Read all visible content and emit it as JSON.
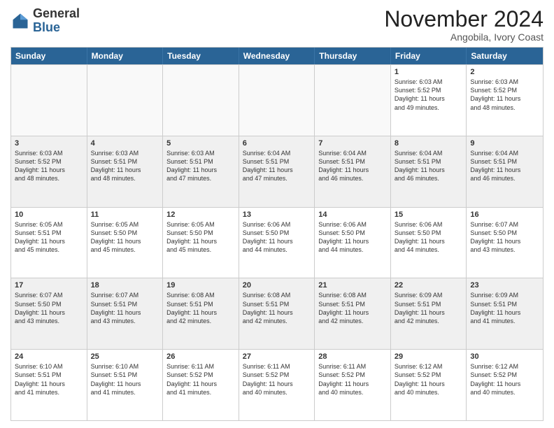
{
  "header": {
    "logo_general": "General",
    "logo_blue": "Blue",
    "month_title": "November 2024",
    "location": "Angobila, Ivory Coast"
  },
  "weekdays": [
    "Sunday",
    "Monday",
    "Tuesday",
    "Wednesday",
    "Thursday",
    "Friday",
    "Saturday"
  ],
  "weeks": [
    [
      {
        "day": "",
        "info": "",
        "empty": true
      },
      {
        "day": "",
        "info": "",
        "empty": true
      },
      {
        "day": "",
        "info": "",
        "empty": true
      },
      {
        "day": "",
        "info": "",
        "empty": true
      },
      {
        "day": "",
        "info": "",
        "empty": true
      },
      {
        "day": "1",
        "info": "Sunrise: 6:03 AM\nSunset: 5:52 PM\nDaylight: 11 hours\nand 49 minutes.",
        "empty": false
      },
      {
        "day": "2",
        "info": "Sunrise: 6:03 AM\nSunset: 5:52 PM\nDaylight: 11 hours\nand 48 minutes.",
        "empty": false
      }
    ],
    [
      {
        "day": "3",
        "info": "Sunrise: 6:03 AM\nSunset: 5:52 PM\nDaylight: 11 hours\nand 48 minutes.",
        "empty": false
      },
      {
        "day": "4",
        "info": "Sunrise: 6:03 AM\nSunset: 5:51 PM\nDaylight: 11 hours\nand 48 minutes.",
        "empty": false
      },
      {
        "day": "5",
        "info": "Sunrise: 6:03 AM\nSunset: 5:51 PM\nDaylight: 11 hours\nand 47 minutes.",
        "empty": false
      },
      {
        "day": "6",
        "info": "Sunrise: 6:04 AM\nSunset: 5:51 PM\nDaylight: 11 hours\nand 47 minutes.",
        "empty": false
      },
      {
        "day": "7",
        "info": "Sunrise: 6:04 AM\nSunset: 5:51 PM\nDaylight: 11 hours\nand 46 minutes.",
        "empty": false
      },
      {
        "day": "8",
        "info": "Sunrise: 6:04 AM\nSunset: 5:51 PM\nDaylight: 11 hours\nand 46 minutes.",
        "empty": false
      },
      {
        "day": "9",
        "info": "Sunrise: 6:04 AM\nSunset: 5:51 PM\nDaylight: 11 hours\nand 46 minutes.",
        "empty": false
      }
    ],
    [
      {
        "day": "10",
        "info": "Sunrise: 6:05 AM\nSunset: 5:51 PM\nDaylight: 11 hours\nand 45 minutes.",
        "empty": false
      },
      {
        "day": "11",
        "info": "Sunrise: 6:05 AM\nSunset: 5:50 PM\nDaylight: 11 hours\nand 45 minutes.",
        "empty": false
      },
      {
        "day": "12",
        "info": "Sunrise: 6:05 AM\nSunset: 5:50 PM\nDaylight: 11 hours\nand 45 minutes.",
        "empty": false
      },
      {
        "day": "13",
        "info": "Sunrise: 6:06 AM\nSunset: 5:50 PM\nDaylight: 11 hours\nand 44 minutes.",
        "empty": false
      },
      {
        "day": "14",
        "info": "Sunrise: 6:06 AM\nSunset: 5:50 PM\nDaylight: 11 hours\nand 44 minutes.",
        "empty": false
      },
      {
        "day": "15",
        "info": "Sunrise: 6:06 AM\nSunset: 5:50 PM\nDaylight: 11 hours\nand 44 minutes.",
        "empty": false
      },
      {
        "day": "16",
        "info": "Sunrise: 6:07 AM\nSunset: 5:50 PM\nDaylight: 11 hours\nand 43 minutes.",
        "empty": false
      }
    ],
    [
      {
        "day": "17",
        "info": "Sunrise: 6:07 AM\nSunset: 5:50 PM\nDaylight: 11 hours\nand 43 minutes.",
        "empty": false
      },
      {
        "day": "18",
        "info": "Sunrise: 6:07 AM\nSunset: 5:51 PM\nDaylight: 11 hours\nand 43 minutes.",
        "empty": false
      },
      {
        "day": "19",
        "info": "Sunrise: 6:08 AM\nSunset: 5:51 PM\nDaylight: 11 hours\nand 42 minutes.",
        "empty": false
      },
      {
        "day": "20",
        "info": "Sunrise: 6:08 AM\nSunset: 5:51 PM\nDaylight: 11 hours\nand 42 minutes.",
        "empty": false
      },
      {
        "day": "21",
        "info": "Sunrise: 6:08 AM\nSunset: 5:51 PM\nDaylight: 11 hours\nand 42 minutes.",
        "empty": false
      },
      {
        "day": "22",
        "info": "Sunrise: 6:09 AM\nSunset: 5:51 PM\nDaylight: 11 hours\nand 42 minutes.",
        "empty": false
      },
      {
        "day": "23",
        "info": "Sunrise: 6:09 AM\nSunset: 5:51 PM\nDaylight: 11 hours\nand 41 minutes.",
        "empty": false
      }
    ],
    [
      {
        "day": "24",
        "info": "Sunrise: 6:10 AM\nSunset: 5:51 PM\nDaylight: 11 hours\nand 41 minutes.",
        "empty": false
      },
      {
        "day": "25",
        "info": "Sunrise: 6:10 AM\nSunset: 5:51 PM\nDaylight: 11 hours\nand 41 minutes.",
        "empty": false
      },
      {
        "day": "26",
        "info": "Sunrise: 6:11 AM\nSunset: 5:52 PM\nDaylight: 11 hours\nand 41 minutes.",
        "empty": false
      },
      {
        "day": "27",
        "info": "Sunrise: 6:11 AM\nSunset: 5:52 PM\nDaylight: 11 hours\nand 40 minutes.",
        "empty": false
      },
      {
        "day": "28",
        "info": "Sunrise: 6:11 AM\nSunset: 5:52 PM\nDaylight: 11 hours\nand 40 minutes.",
        "empty": false
      },
      {
        "day": "29",
        "info": "Sunrise: 6:12 AM\nSunset: 5:52 PM\nDaylight: 11 hours\nand 40 minutes.",
        "empty": false
      },
      {
        "day": "30",
        "info": "Sunrise: 6:12 AM\nSunset: 5:52 PM\nDaylight: 11 hours\nand 40 minutes.",
        "empty": false
      }
    ]
  ]
}
